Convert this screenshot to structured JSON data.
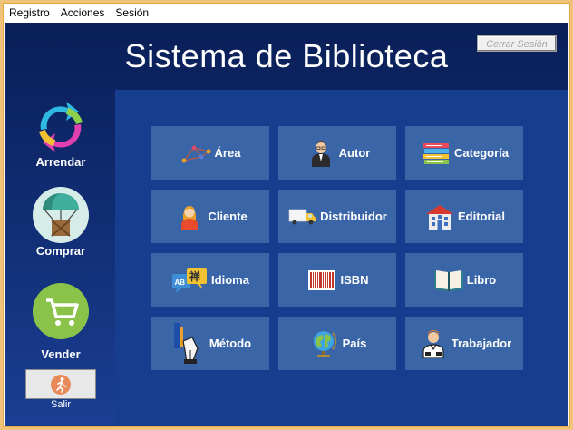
{
  "menubar": {
    "items": [
      "Registro",
      "Acciones",
      "Sesión"
    ]
  },
  "header": {
    "title": "Sistema de Biblioteca",
    "logout_label": "Cerrar Sesión"
  },
  "sidebar": {
    "items": [
      {
        "label": "Arrendar",
        "icon": "refresh-arrows-icon"
      },
      {
        "label": "Comprar",
        "icon": "parachute-box-icon"
      },
      {
        "label": "Vender",
        "icon": "shopping-cart-icon"
      }
    ],
    "exit": {
      "label": "Salir",
      "icon": "running-person-icon"
    }
  },
  "tiles": [
    {
      "label": "Área",
      "icon": "network-nodes-icon"
    },
    {
      "label": "Autor",
      "icon": "author-person-icon"
    },
    {
      "label": "Categoría",
      "icon": "stacked-books-icon"
    },
    {
      "label": "Cliente",
      "icon": "client-woman-icon"
    },
    {
      "label": "Distribuidor",
      "icon": "delivery-truck-icon"
    },
    {
      "label": "Editorial",
      "icon": "publisher-building-icon"
    },
    {
      "label": "Idioma",
      "icon": "language-bubbles-icon"
    },
    {
      "label": "ISBN",
      "icon": "barcode-icon"
    },
    {
      "label": "Libro",
      "icon": "open-book-icon"
    },
    {
      "label": "Método",
      "icon": "fountain-pen-icon"
    },
    {
      "label": "País",
      "icon": "globe-icon"
    },
    {
      "label": "Trabajador",
      "icon": "worker-icon"
    }
  ],
  "colors": {
    "background_top": "#0a1f57",
    "background_bottom": "#1a3f92",
    "panel": "#173d8e",
    "tile": "#3a66a8",
    "accent_border": "#e6a94a"
  }
}
